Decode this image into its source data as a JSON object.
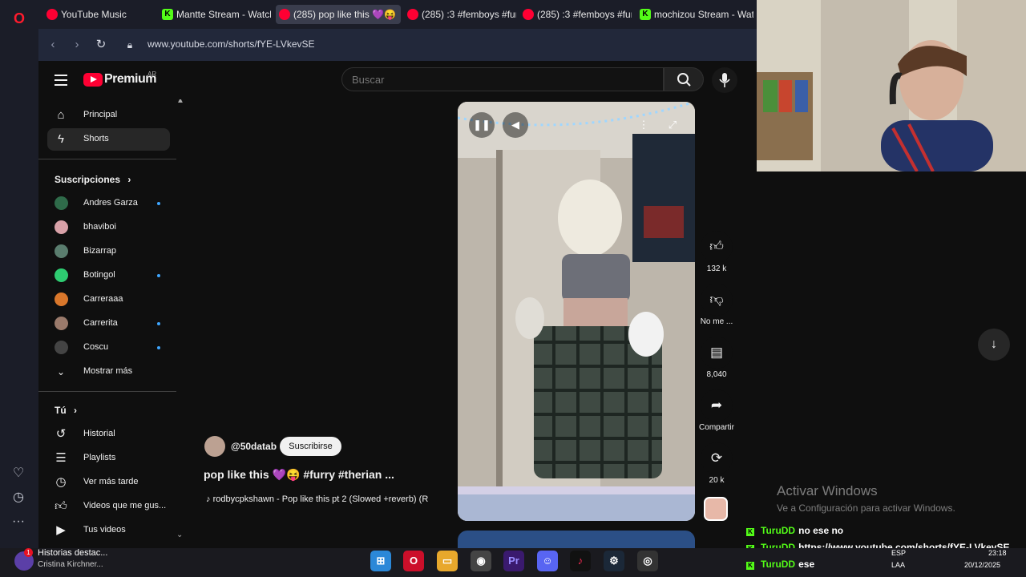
{
  "tabs": [
    {
      "label": "YouTube Music",
      "favicon": "youtube-icon",
      "active": false
    },
    {
      "label": "Mantte Stream - Watch",
      "favicon": "kick-icon",
      "active": false
    },
    {
      "label": "(285) pop like this 💜😝",
      "favicon": "youtube-icon",
      "active": true
    },
    {
      "label": "(285) :3 #femboys #furr",
      "favicon": "youtube-icon",
      "active": false
    },
    {
      "label": "(285) :3 #femboys #furr",
      "favicon": "youtube-icon",
      "active": false
    },
    {
      "label": "mochizou Stream - Wat",
      "favicon": "kick-icon",
      "active": false
    }
  ],
  "address_bar": {
    "url": "www.youtube.com/shorts/fYE-LVkevSE"
  },
  "header": {
    "brand": "Premium",
    "country": "AR",
    "search_placeholder": "Buscar"
  },
  "sidebar": {
    "main": [
      {
        "label": "Principal",
        "icon": "home-icon"
      },
      {
        "label": "Shorts",
        "icon": "shorts-icon",
        "active": true
      }
    ],
    "subscriptions_title": "Suscripciones",
    "subscriptions": [
      {
        "label": "Andres Garza",
        "color": "#2f6b4a",
        "new": true
      },
      {
        "label": "bhaviboi",
        "color": "#d8a1a8",
        "new": false
      },
      {
        "label": "Bizarrap",
        "color": "#5a7d6e",
        "new": false
      },
      {
        "label": "Botingol",
        "color": "#2ecc71",
        "new": true
      },
      {
        "label": "Carreraaa",
        "color": "#d9772b",
        "new": false
      },
      {
        "label": "Carrerita",
        "color": "#9a7a6b",
        "new": true
      },
      {
        "label": "Coscu",
        "color": "#444444",
        "new": true
      }
    ],
    "show_more": "Mostrar más",
    "you_title": "Tú",
    "you_items": [
      {
        "label": "Historial",
        "icon": "history-icon"
      },
      {
        "label": "Playlists",
        "icon": "playlist-icon"
      },
      {
        "label": "Ver más tarde",
        "icon": "clock-icon"
      },
      {
        "label": "Videos que me gus...",
        "icon": "thumbs-up-icon"
      },
      {
        "label": "Tus videos",
        "icon": "video-icon"
      }
    ]
  },
  "short": {
    "channel": "@50datab",
    "subscribe": "Suscribirse",
    "title": "pop like this 💜😝 #furry #therian ...",
    "music": "rodbycpkshawn - Pop like this pt 2 (Slowed +reverb) (R",
    "actions": [
      {
        "icon": "thumbs-up-icon",
        "label": "132 k"
      },
      {
        "icon": "thumbs-down-icon",
        "label": "No me ..."
      },
      {
        "icon": "comment-icon",
        "label": "8,040"
      },
      {
        "icon": "share-icon",
        "label": "Compartir"
      },
      {
        "icon": "remix-icon",
        "label": "20 k"
      }
    ]
  },
  "activate_windows": {
    "title": "Activar Windows",
    "subtitle": "Ve a Configuración para activar Windows."
  },
  "chat": [
    {
      "user": "TuruDD",
      "message": "no ese no"
    },
    {
      "user": "TuruDD",
      "message": "https://www.youtube.com/shorts/fYE-LVkevSE"
    },
    {
      "user": "TuruDD",
      "message": "ese"
    }
  ],
  "taskbar": {
    "news_badge": "1",
    "news_title": "Historias destac...",
    "news_subtitle": "Cristina Kirchner...",
    "lang_top": "ESP",
    "lang_bottom": "LAA",
    "time": "23:18",
    "date": "20/12/2025"
  }
}
